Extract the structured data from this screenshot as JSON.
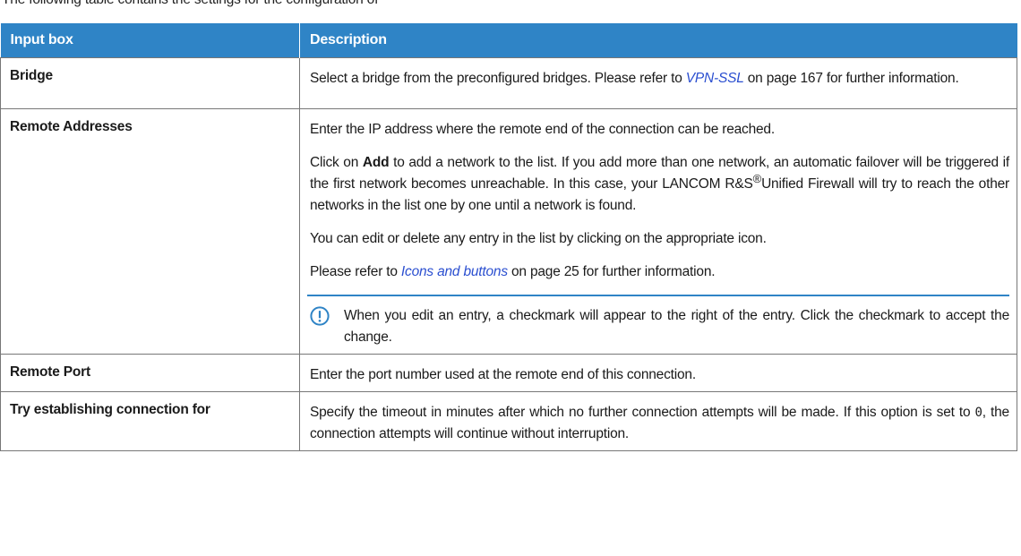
{
  "intro_partial": "The following table contains the settings for the configuration of",
  "table": {
    "headers": [
      "Input box",
      "Description"
    ],
    "bridge": {
      "label": "Bridge",
      "desc_pre": "Select a bridge from the preconfigured bridges. Please refer to ",
      "link": "VPN-SSL",
      "desc_post": " on page 167 for further information."
    },
    "remote_addresses": {
      "label": "Remote Addresses",
      "p1": "Enter the IP address where the remote end of the connection can be reached.",
      "p2_pre": "Click on ",
      "p2_bold": "Add",
      "p2_mid": " to add a network to the list. If you add more than one network, an automatic failover will be triggered if the first network becomes unreachable. In this case, your LANCOM R&S",
      "p2_reg": "®",
      "p2_post": "Unified Firewall will try to reach the other networks in the list one by one until a network is found.",
      "p3": "You can edit or delete any entry in the list by clicking on the appropriate icon.",
      "p4_pre": "Please refer to ",
      "p4_link": "Icons and buttons",
      "p4_post": " on page 25 for further information.",
      "note": "When you edit an entry, a checkmark will appear to the right of the entry. Click the checkmark to accept the change.",
      "note_icon": "exclamation-circle-icon"
    },
    "remote_port": {
      "label": "Remote Port",
      "desc": "Enter the port number used at the remote end of this connection."
    },
    "try_connection": {
      "label": "Try establishing connection for",
      "desc_pre": "Specify the timeout in minutes after which no further connection attempts will be made. If this option is set to ",
      "code": "0",
      "desc_post": ", the connection attempts will continue without interruption."
    }
  },
  "colors": {
    "header_bg": "#2f84c6",
    "link": "#2b4fd0",
    "border": "#777777"
  }
}
